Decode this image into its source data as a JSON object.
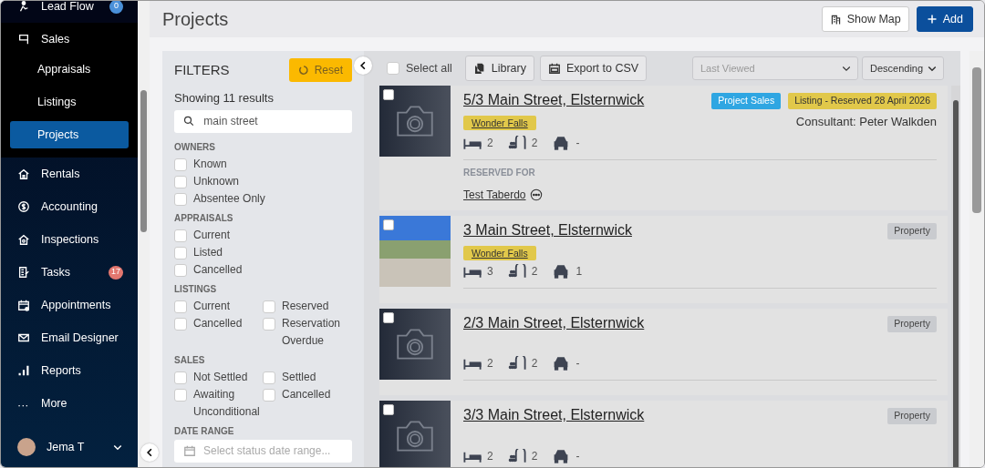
{
  "sidebar": {
    "items": [
      {
        "label": "Lead Flow",
        "badge": "0",
        "color": "#4a90d9",
        "selected": false
      },
      {
        "label": "Sales",
        "selected": false,
        "expanded": true,
        "children": [
          {
            "label": "Appraisals",
            "selected": false
          },
          {
            "label": "Listings",
            "selected": false
          },
          {
            "label": "Projects",
            "selected": true
          }
        ]
      },
      {
        "label": "Rentals",
        "selected": false
      },
      {
        "label": "Accounting",
        "selected": false
      },
      {
        "label": "Inspections",
        "selected": false
      },
      {
        "label": "Tasks",
        "badge": "17",
        "color": "#e3776f",
        "selected": false
      },
      {
        "label": "Appointments",
        "selected": false
      },
      {
        "label": "Email Designer",
        "selected": false
      },
      {
        "label": "Reports",
        "selected": false
      },
      {
        "label": "More",
        "icon_text": "···",
        "selected": false
      }
    ],
    "user": {
      "name": "Jema T"
    }
  },
  "header": {
    "title": "Projects",
    "buttons": [
      {
        "label": "Show Map",
        "kind": "outline"
      },
      {
        "label": "Add",
        "kind": "primary"
      }
    ]
  },
  "filters": {
    "title": "FILTERS",
    "reset": "Reset",
    "results": "Showing 11 results",
    "search": {
      "value": "main street"
    },
    "groups": [
      {
        "title": "OWNERS",
        "kind": "single",
        "options": [
          {
            "label": "Known",
            "checked": false
          },
          {
            "label": "Unknown",
            "checked": false
          },
          {
            "label": "Absentee Only",
            "checked": false
          }
        ]
      },
      {
        "title": "APPRAISALS",
        "kind": "single",
        "options": [
          {
            "label": "Current",
            "checked": false
          },
          {
            "label": "Listed",
            "checked": false
          },
          {
            "label": "Cancelled",
            "checked": false
          }
        ]
      },
      {
        "title": "LISTINGS",
        "kind": "double",
        "options": [
          {
            "label": "Current",
            "checked": false
          },
          {
            "label": "Reserved",
            "checked": false
          },
          {
            "label": "Cancelled",
            "checked": false
          },
          {
            "label": "Reservation Overdue",
            "checked": false
          }
        ]
      },
      {
        "title": "SALES",
        "kind": "double",
        "options": [
          {
            "label": "Not Settled",
            "checked": false
          },
          {
            "label": "Settled",
            "checked": false
          },
          {
            "label": "Awaiting Unconditional",
            "checked": false
          },
          {
            "label": "Cancelled",
            "checked": false
          }
        ]
      }
    ],
    "date_range": {
      "title": "DATE RANGE",
      "placeholder": "Select status date range..."
    }
  },
  "toolbar": {
    "select_all": {
      "label": "Select all",
      "checked": false
    },
    "buttons": [
      {
        "label": "Library"
      },
      {
        "label": "Export to CSV"
      }
    ],
    "sort_field": {
      "placeholder": "Last Viewed"
    },
    "sort_order": {
      "value": "Descending"
    }
  },
  "properties": [
    {
      "address": "5/3 Main Street, Elsternwick",
      "checked": false,
      "has_photo": false,
      "project": "Wonder Falls",
      "badges": [
        {
          "label": "Project Sales",
          "kind": "project"
        },
        {
          "label": "Listing - Reserved 28 April 2026",
          "kind": "listing"
        }
      ],
      "consultant": "Consultant: Peter Walkden",
      "beds": "2",
      "baths": "2",
      "cars": "-",
      "reserved_for": {
        "title": "RESERVED FOR",
        "name": "Test Taberdo"
      }
    },
    {
      "address": "3 Main Street, Elsternwick",
      "checked": false,
      "has_photo": true,
      "project": "Wonder Falls",
      "badges": [
        {
          "label": "Property",
          "kind": "property"
        }
      ],
      "beds": "3",
      "baths": "2",
      "cars": "1"
    },
    {
      "address": "2/3 Main Street, Elsternwick",
      "checked": false,
      "has_photo": false,
      "badges": [
        {
          "label": "Property",
          "kind": "property"
        }
      ],
      "beds": "2",
      "baths": "2",
      "cars": "-"
    },
    {
      "address": "3/3 Main Street, Elsternwick",
      "checked": false,
      "has_photo": false,
      "badges": [
        {
          "label": "Property",
          "kind": "property"
        }
      ],
      "beds": "2",
      "baths": "2",
      "cars": "-"
    }
  ]
}
